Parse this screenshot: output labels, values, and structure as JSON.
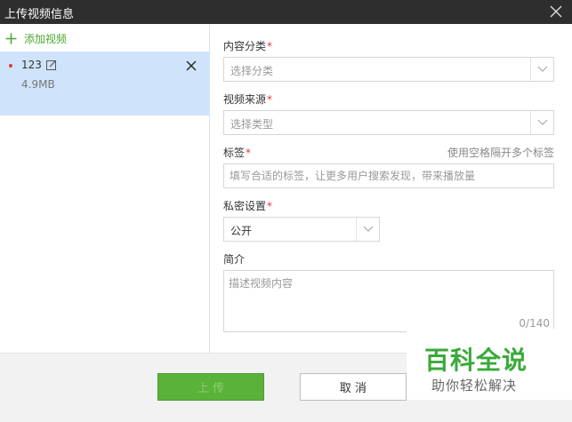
{
  "window": {
    "title": "上传视频信息"
  },
  "left": {
    "add_label": "添加视频",
    "items": [
      {
        "name": "123",
        "size": "4.9MB"
      }
    ]
  },
  "form": {
    "category": {
      "label": "内容分类",
      "required": "*",
      "placeholder": "选择分类"
    },
    "source": {
      "label": "视频来源",
      "required": "*",
      "placeholder": "选择类型"
    },
    "tags": {
      "label": "标签",
      "required": "*",
      "hint": "使用空格隔开多个标签",
      "placeholder": "填写合适的标签，让更多用户搜索发现，带来播放量"
    },
    "privacy": {
      "label": "私密设置",
      "required": "*",
      "value": "公开"
    },
    "intro": {
      "label": "简介",
      "placeholder": "描述视频内容",
      "counter": "0/140"
    }
  },
  "footer": {
    "upload_label": "上 传",
    "cancel_label": "取 消"
  },
  "watermark": {
    "main": "百科全说",
    "sub": "助你轻松解决"
  },
  "colors": {
    "accent": "#5ab23a",
    "selected_row": "#cfe4fa",
    "required": "#e0393b",
    "titlebar": "#2e2e2e"
  }
}
